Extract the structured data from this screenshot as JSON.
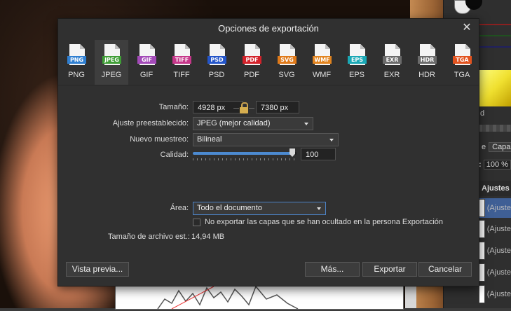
{
  "dialog": {
    "title": "Opciones de exportación",
    "close_glyph": "✕"
  },
  "formats": [
    {
      "label": "PNG",
      "badge": "PNG",
      "color": "#2f7fd1",
      "selected": false
    },
    {
      "label": "JPEG",
      "badge": "JPEG",
      "color": "#3f9e36",
      "selected": true
    },
    {
      "label": "GIF",
      "badge": "GIF",
      "color": "#a34ab8",
      "selected": false
    },
    {
      "label": "TIFF",
      "badge": "TIFF",
      "color": "#c6378a",
      "selected": false
    },
    {
      "label": "PSD",
      "badge": "PSD",
      "color": "#2455c9",
      "selected": false
    },
    {
      "label": "PDF",
      "badge": "PDF",
      "color": "#d3222a",
      "selected": false
    },
    {
      "label": "SVG",
      "badge": "SVG",
      "color": "#e07a1a",
      "selected": false
    },
    {
      "label": "WMF",
      "badge": "WMF",
      "color": "#e2841f",
      "selected": false
    },
    {
      "label": "EPS",
      "badge": "EPS",
      "color": "#1aa8b5",
      "selected": false
    },
    {
      "label": "EXR",
      "badge": "EXR",
      "color": "#6b6b6b",
      "selected": false
    },
    {
      "label": "HDR",
      "badge": "HDR",
      "color": "#6b6b6b",
      "selected": false
    },
    {
      "label": "TGA",
      "badge": "TGA",
      "color": "#e2531f",
      "selected": false
    }
  ],
  "size": {
    "label": "Tamaño:",
    "width": "4928 px",
    "height": "7380 px"
  },
  "preset": {
    "label": "Ajuste preestablecido:",
    "value": "JPEG (mejor calidad)"
  },
  "resample": {
    "label": "Nuevo muestreo:",
    "value": "Bilineal"
  },
  "quality": {
    "label": "Calidad:",
    "value": "100",
    "level": 1.0
  },
  "area": {
    "label": "Área:",
    "value": "Todo el documento"
  },
  "hidden_layers": {
    "label": "No exportar las capas que se han ocultado en la persona Exportación",
    "checked": false
  },
  "file_size": {
    "label": "Tamaño de archivo est.:",
    "value": "14,94 MB"
  },
  "buttons": {
    "preview": "Vista previa...",
    "more": "Más...",
    "export": "Exportar",
    "cancel": "Cancelar"
  },
  "background_panel": {
    "gradient_label": "d",
    "tab_partial": "e",
    "tab_layers": "Capas",
    "zoom_prefix": ":",
    "zoom": "100 %",
    "adjustments_header": "Ajustes",
    "layers": [
      "(Ajuste",
      "(Ajuste",
      "(Ajuste",
      "(Ajuste",
      "(Ajuste"
    ]
  }
}
